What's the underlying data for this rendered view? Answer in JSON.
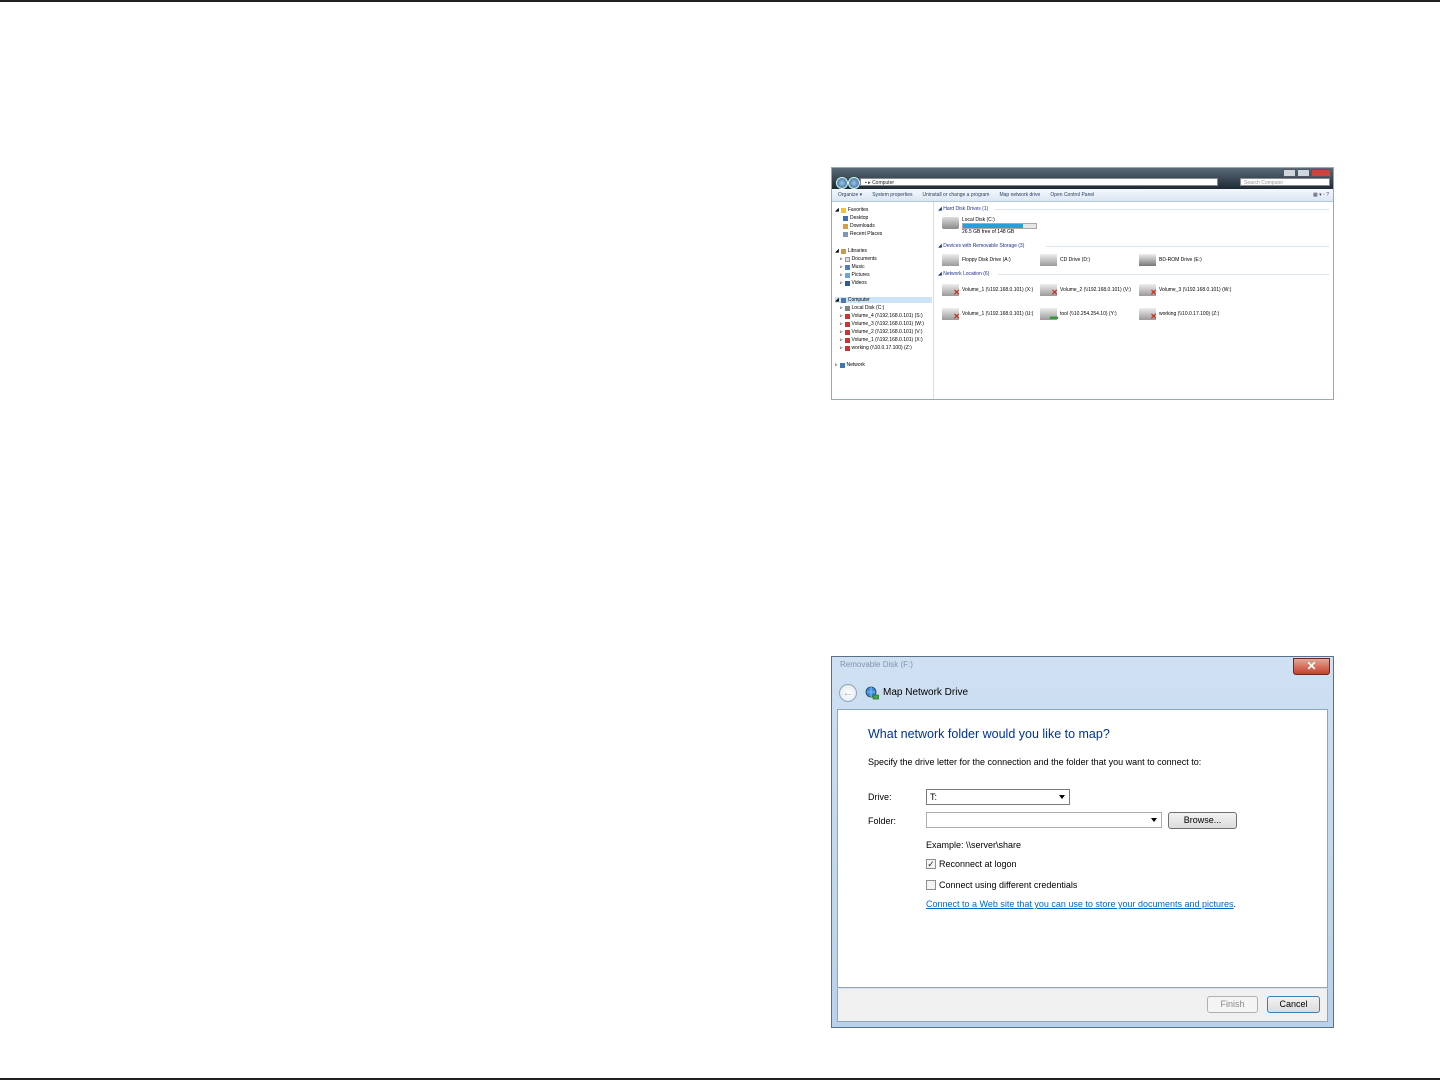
{
  "explorer": {
    "address": "Computer",
    "search_placeholder": "Search Computer",
    "toolbar": [
      "Organize ▾",
      "System properties",
      "Uninstall or change a program",
      "Map network drive",
      "Open Control Panel"
    ],
    "nav": {
      "favorites": "Favorites",
      "favorites_items": [
        "Desktop",
        "Downloads",
        "Recent Places"
      ],
      "libraries": "Libraries",
      "libraries_items": [
        "Documents",
        "Music",
        "Pictures",
        "Videos"
      ],
      "computer": "Computer",
      "computer_items": [
        "Local Disk (C:)",
        "Volume_4 (\\\\192.168.0.101) (S:)",
        "Volume_3 (\\\\192.168.0.101) (W:)",
        "Volume_2 (\\\\192.168.0.101) (V:)",
        "Volume_1 (\\\\192.168.0.101) (X:)",
        "working (\\\\10.0.17.100) (Z:)"
      ],
      "network": "Network"
    },
    "groups": {
      "hdd": "Hard Disk Drives (1)",
      "removable": "Devices with Removable Storage (3)",
      "network": "Network Location (6)"
    },
    "local_disk": {
      "name": "Local Disk (C:)",
      "free": "26.5 GB free of 148 GB",
      "used_fraction": 0.82
    },
    "removable_items": [
      "Floppy Disk Drive (A:)",
      "CD Drive (D:)",
      "BD-ROM Drive (E:)"
    ],
    "network_items": [
      "Volume_1 (\\\\192.168.0.101) (X:)",
      "Volume_2 (\\\\192.168.0.101) (V:)",
      "Volume_3 (\\\\192.168.0.101) (W:)",
      "Volume_1 (\\\\192.168.0.101) (U:)",
      "tool (\\\\10.254.254.10) (Y:)",
      "working (\\\\10.0.17.100) (Z:)"
    ]
  },
  "dialog": {
    "bg_title": "Removable Disk (F:)",
    "close_label": "✕",
    "title": "Map Network Drive",
    "heading": "What network folder would you like to map?",
    "instruction": "Specify the drive letter for the connection and the folder that you want to connect to:",
    "drive_label": "Drive:",
    "drive_value": "T:",
    "folder_label": "Folder:",
    "folder_value": "",
    "browse_label": "Browse...",
    "example": "Example: \\\\server\\share",
    "reconnect_label": "Reconnect at logon",
    "reconnect_checked": true,
    "credentials_label": "Connect using different credentials",
    "credentials_checked": false,
    "link_text": "Connect to a Web site that you can use to store your documents and pictures",
    "link_suffix": ".",
    "finish_label": "Finish",
    "cancel_label": "Cancel"
  }
}
